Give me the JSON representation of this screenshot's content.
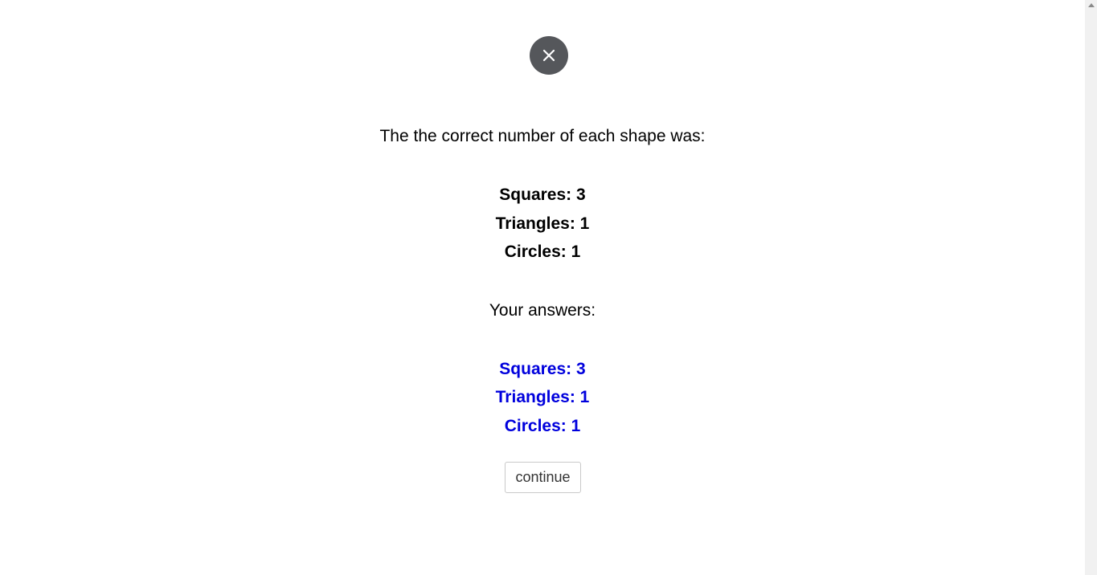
{
  "close_button": {
    "icon": "close-icon",
    "background": "#55575b"
  },
  "intro_text": "The the correct number of each shape was:",
  "correct_counts": [
    {
      "label": "Squares: 3"
    },
    {
      "label": "Triangles: 1"
    },
    {
      "label": "Circles: 1"
    }
  ],
  "answers_heading": "Your answers:",
  "your_answers": [
    {
      "label": "Squares: 3"
    },
    {
      "label": "Triangles: 1"
    },
    {
      "label": "Circles: 1"
    }
  ],
  "answer_color": "#0000dd",
  "continue_label": "continue"
}
